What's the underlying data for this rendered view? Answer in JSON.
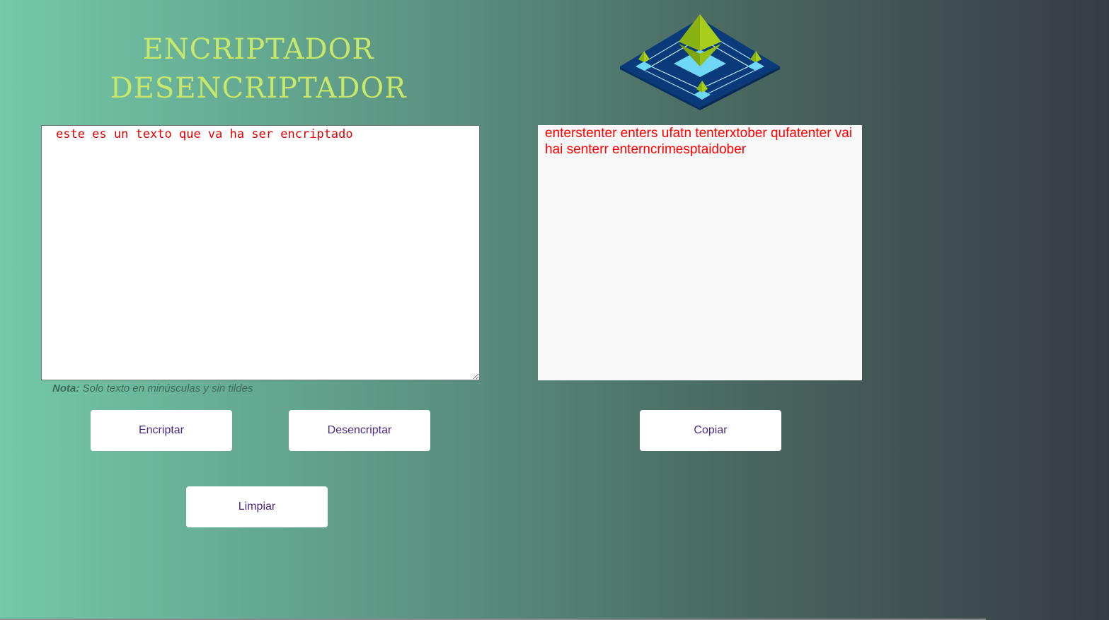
{
  "header": {
    "title_line1": "ENCRIPTADOR",
    "title_line2": "DESENCRIPTADOR"
  },
  "logo": {
    "icon": "ethereum-crystal-logo-icon"
  },
  "input": {
    "value": "este es un texto que va ha ser encriptado",
    "text_color": "#e00000"
  },
  "note": {
    "label": "Nota:",
    "text": "Solo texto en minúsculas y sin tildes"
  },
  "output": {
    "value": "enterstenter enters ufatn tenterxtober qufatenter vai hai senterr enterncrimesptaidober",
    "text_color": "#ff0000"
  },
  "buttons": {
    "encriptar": "Encriptar",
    "desencriptar": "Desencriptar",
    "copiar": "Copiar",
    "limpiar": "Limpiar"
  },
  "colors": {
    "title": "#c7e86a",
    "button_text": "#4b2a86",
    "gradient_start": "#74c9aa",
    "gradient_end": "#373b45"
  }
}
